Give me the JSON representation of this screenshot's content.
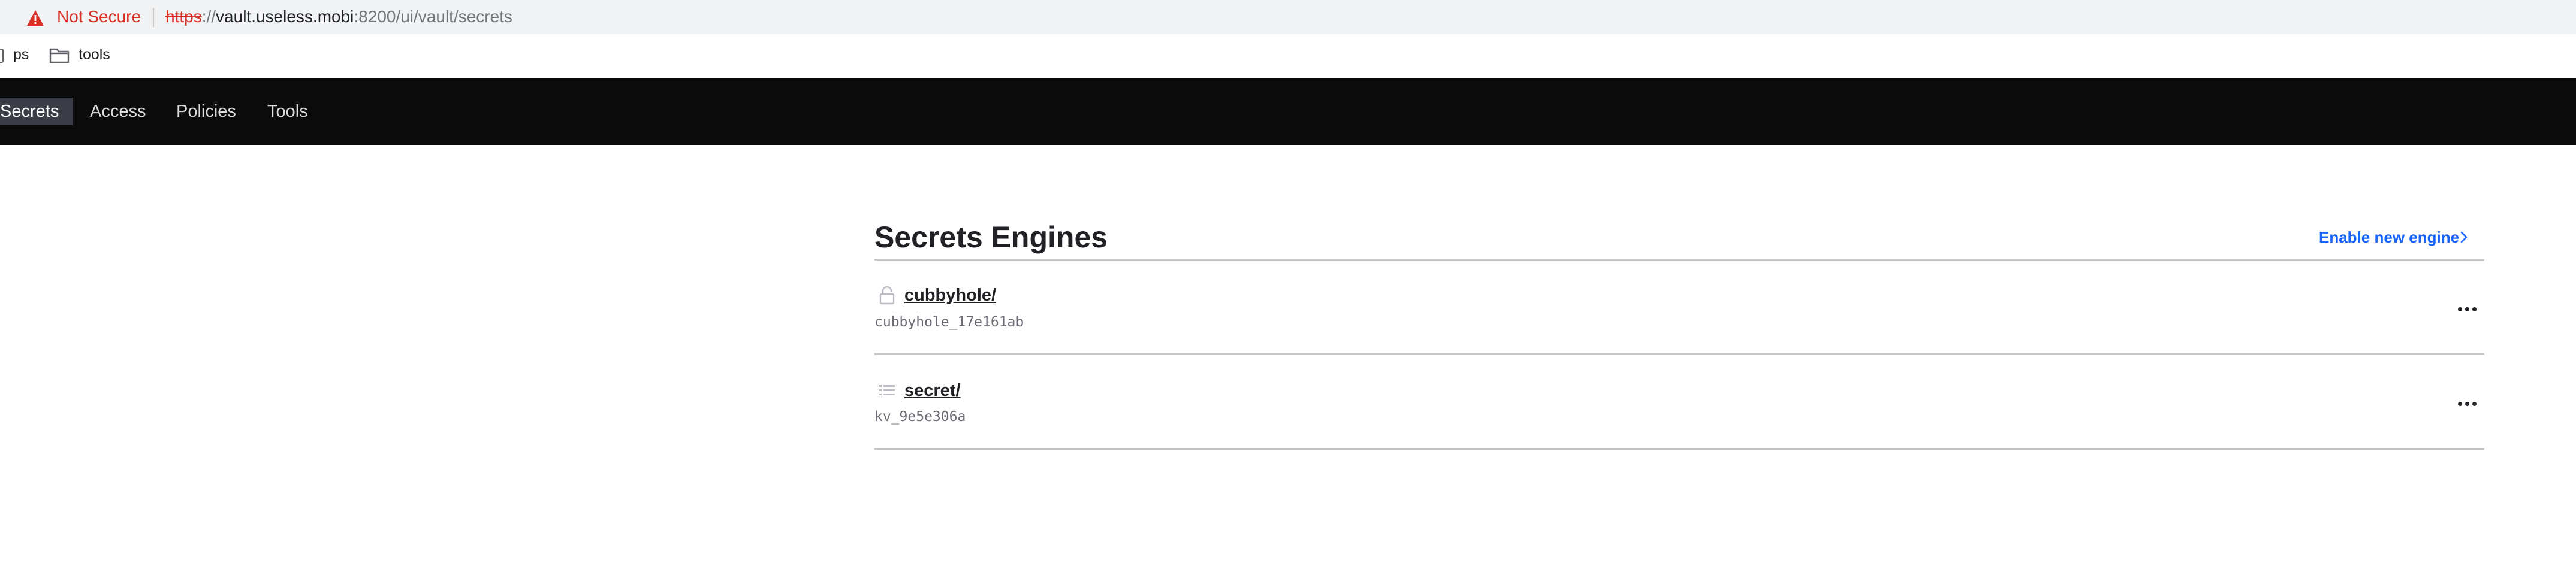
{
  "browser": {
    "security_label": "Not Secure",
    "url_scheme": "https",
    "url_sep": "://",
    "url_host": "vault.useless.mobi",
    "url_path": ":8200/ui/vault/secrets"
  },
  "bookmarks": [
    {
      "label": "ps",
      "icon": "bookmark-page-icon"
    },
    {
      "label": "tools",
      "icon": "folder-icon"
    }
  ],
  "nav": {
    "items": [
      {
        "label": "Secrets",
        "active": true
      },
      {
        "label": "Access",
        "active": false
      },
      {
        "label": "Policies",
        "active": false
      },
      {
        "label": "Tools",
        "active": false
      }
    ]
  },
  "main": {
    "title": "Secrets Engines",
    "enable_label": "Enable new engine",
    "engines": [
      {
        "path": "cubbyhole/",
        "accessor": "cubbyhole_17e161ab",
        "icon": "lock-icon"
      },
      {
        "path": "secret/",
        "accessor": "kv_9e5e306a",
        "icon": "list-icon"
      }
    ]
  },
  "colors": {
    "nav_bg": "#0b0b0b",
    "nav_active_bg": "#3a3d46",
    "link_blue": "#1563ff",
    "warning_red": "#d93025"
  }
}
